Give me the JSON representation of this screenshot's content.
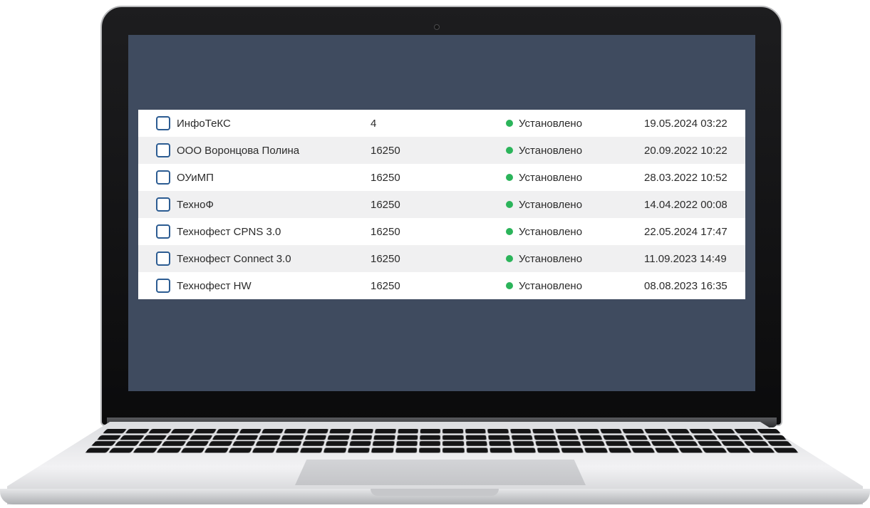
{
  "table": {
    "status_color": "#2bb45a",
    "rows": [
      {
        "name": "ИнфоТеКС",
        "port": "4",
        "status": "Установлено",
        "date": "19.05.2024 03:22"
      },
      {
        "name": "ООО Воронцова Полина",
        "port": "16250",
        "status": "Установлено",
        "date": "20.09.2022 10:22"
      },
      {
        "name": "ОУиМП",
        "port": "16250",
        "status": "Установлено",
        "date": "28.03.2022 10:52"
      },
      {
        "name": "ТехноФ",
        "port": "16250",
        "status": "Установлено",
        "date": "14.04.2022 00:08"
      },
      {
        "name": "Технофест CPNS 3.0",
        "port": "16250",
        "status": "Установлено",
        "date": "22.05.2024 17:47"
      },
      {
        "name": "Технофест Connect 3.0",
        "port": "16250",
        "status": "Установлено",
        "date": "11.09.2023 14:49"
      },
      {
        "name": "Технофест HW",
        "port": "16250",
        "status": "Установлено",
        "date": "08.08.2023 16:35"
      }
    ]
  }
}
